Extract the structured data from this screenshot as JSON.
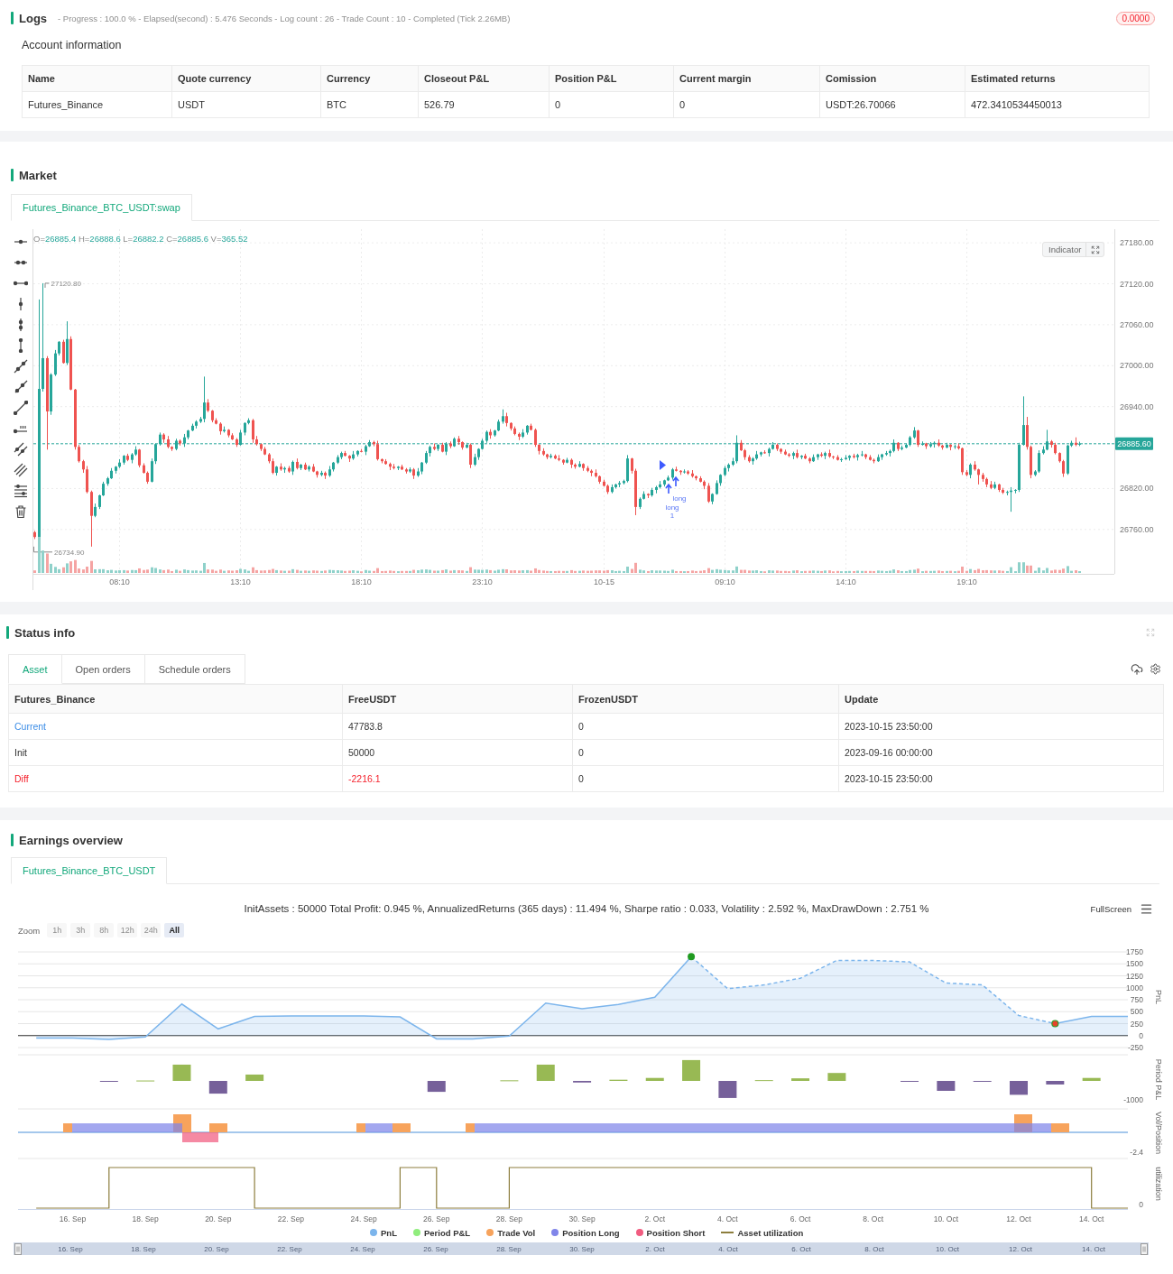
{
  "logs": {
    "title": "Logs",
    "summary": "- Progress : 100.0 % - Elapsed(second) : 5.476 Seconds - Log count : 26 - Trade Count : 10 - Completed (Tick 2.26MB)",
    "badge": "0.0000"
  },
  "account": {
    "title": "Account information",
    "columns": [
      "Name",
      "Quote currency",
      "Currency",
      "Closeout P&L",
      "Position P&L",
      "Current margin",
      "Comission",
      "Estimated returns"
    ],
    "rows": [
      [
        "Futures_Binance",
        "USDT",
        "BTC",
        "526.79",
        "0",
        "0",
        "USDT:26.70066",
        "472.3410534450013"
      ]
    ]
  },
  "market": {
    "title": "Market",
    "tabs": [
      {
        "label": "Futures_Binance_BTC_USDT:swap",
        "selected": true
      }
    ],
    "chart": {
      "readout": [
        {
          "key": "O=",
          "value": "26885.4"
        },
        {
          "key": "H=",
          "value": "26888.6"
        },
        {
          "key": "L=",
          "value": "26882.2"
        },
        {
          "key": "C=",
          "value": "26885.6"
        },
        {
          "key": "V=",
          "value": "365.52"
        }
      ],
      "indicator": "Indicator",
      "high_label": "27120.80",
      "low_label": "26734.90",
      "signals": [
        {
          "label": "long"
        },
        {
          "label": "long",
          "count": "1"
        }
      ],
      "chart_data": {
        "type": "candlestick",
        "grid": true,
        "ylim": [
          26695,
          27200
        ],
        "yticks": [
          {
            "value": 27180,
            "label": "27180.00"
          },
          {
            "value": 27120,
            "label": "27120.00"
          },
          {
            "value": 27060,
            "label": "27060.00"
          },
          {
            "value": 27000,
            "label": "27000.00"
          },
          {
            "value": 26940,
            "label": "26940.00"
          },
          {
            "value": 26820,
            "label": "26820.00"
          },
          {
            "value": 26760,
            "label": "26760.00"
          }
        ],
        "ref_lines": [
          {
            "axis": "y",
            "value": 26885.6,
            "label": "26885.60"
          }
        ],
        "categories": [
          null,
          null,
          null,
          null,
          null,
          null,
          null,
          null,
          null,
          null,
          null,
          null,
          null,
          null,
          null,
          null,
          null,
          null,
          null,
          null,
          null,
          "08:10",
          null,
          null,
          null,
          null,
          null,
          null,
          null,
          null,
          null,
          null,
          null,
          null,
          null,
          null,
          null,
          null,
          null,
          null,
          null,
          null,
          null,
          null,
          null,
          null,
          null,
          null,
          null,
          null,
          null,
          "13:10",
          null,
          null,
          null,
          null,
          null,
          null,
          null,
          null,
          null,
          null,
          null,
          null,
          null,
          null,
          null,
          null,
          null,
          null,
          null,
          null,
          null,
          null,
          null,
          null,
          null,
          null,
          null,
          null,
          null,
          "18:10",
          null,
          null,
          null,
          null,
          null,
          null,
          null,
          null,
          null,
          null,
          null,
          null,
          null,
          null,
          null,
          null,
          null,
          null,
          null,
          null,
          null,
          null,
          null,
          null,
          null,
          null,
          null,
          null,
          null,
          "23:10",
          null,
          null,
          null,
          null,
          null,
          null,
          null,
          null,
          null,
          null,
          null,
          null,
          null,
          null,
          null,
          null,
          null,
          null,
          null,
          null,
          null,
          null,
          null,
          null,
          null,
          null,
          null,
          null,
          null,
          "10-15",
          null,
          null,
          null,
          null,
          null,
          null,
          null,
          null,
          null,
          null,
          null,
          null,
          null,
          null,
          null,
          null,
          null,
          null,
          null,
          null,
          null,
          null,
          null,
          null,
          null,
          null,
          null,
          null,
          null,
          "09:10",
          null,
          null,
          null,
          null,
          null,
          null,
          null,
          null,
          null,
          null,
          null,
          null,
          null,
          null,
          null,
          null,
          null,
          null,
          null,
          null,
          null,
          null,
          null,
          null,
          null,
          null,
          null,
          null,
          null,
          "14:10",
          null,
          null,
          null,
          null,
          null,
          null,
          null,
          null,
          null,
          null,
          null,
          null,
          null,
          null,
          null,
          null,
          null,
          null,
          null,
          null,
          null,
          null,
          null,
          null,
          null,
          null,
          null,
          null,
          null,
          "19:10",
          null,
          null,
          null,
          null,
          null,
          null,
          null,
          null,
          null,
          null,
          null,
          null,
          null,
          null,
          null,
          null,
          null,
          null,
          null,
          null,
          null,
          null,
          null,
          null,
          null,
          null,
          null,
          null
        ],
        "ohlc": [
          [
            26756,
            26758,
            26746,
            26749
          ],
          [
            26749,
            27097,
            26748,
            26966
          ],
          [
            26966,
            27120.8,
            26962,
            27011
          ],
          [
            27011,
            27014,
            26877,
            26933
          ],
          [
            26933,
            26989,
            26928,
            26987
          ],
          [
            26987,
            27023,
            26985,
            27018
          ],
          [
            27018,
            27036,
            27015,
            27035
          ],
          [
            27035,
            27038,
            27003,
            27004
          ],
          [
            27004,
            27065,
            27001,
            27039
          ],
          [
            27039,
            27043,
            26964,
            26965
          ],
          [
            26965,
            26966,
            26877,
            26881
          ],
          [
            26881,
            26884,
            26858,
            26860
          ],
          [
            26860,
            26862,
            26843,
            26848
          ],
          [
            26848,
            26853,
            26813,
            26815
          ],
          [
            26815,
            26817,
            26734.9,
            26780
          ],
          [
            26780,
            26798,
            26778,
            26793
          ],
          [
            26793,
            26811,
            26790,
            26810
          ],
          [
            26810,
            26830,
            26809,
            26827
          ],
          [
            26827,
            26837,
            26824,
            26835
          ],
          [
            26835,
            26850,
            26834,
            26846
          ],
          [
            26846,
            26853,
            26842,
            26852
          ],
          [
            26852,
            26863,
            26850,
            26858
          ],
          [
            26858,
            26869,
            26855,
            26868
          ],
          [
            26868,
            26871,
            26860,
            26862
          ],
          [
            26862,
            26872,
            26857,
            26870
          ],
          [
            26870,
            26882,
            26868,
            26877
          ],
          [
            26877,
            26878,
            26851,
            26854
          ],
          [
            26854,
            26857,
            26842,
            26843
          ],
          [
            26843,
            26845,
            26827,
            26830
          ],
          [
            26830,
            26864,
            26829,
            26860
          ],
          [
            26860,
            26886,
            26856,
            26885
          ],
          [
            26885,
            26902,
            26883,
            26899
          ],
          [
            26899,
            26901,
            26887,
            26892
          ],
          [
            26892,
            26897,
            26879,
            26881
          ],
          [
            26881,
            26882,
            26875,
            26878
          ],
          [
            26878,
            26893,
            26876,
            26890
          ],
          [
            26890,
            26892,
            26883,
            26886
          ],
          [
            26886,
            26900,
            26881,
            26895
          ],
          [
            26895,
            26906,
            26892,
            26905
          ],
          [
            26905,
            26915,
            26904,
            26912
          ],
          [
            26912,
            26920,
            26908,
            26918
          ],
          [
            26918,
            26925,
            26916,
            26922
          ],
          [
            26922,
            26984,
            26917,
            26946
          ],
          [
            26946,
            26951,
            26932,
            26934
          ],
          [
            26934,
            26935,
            26917,
            26920
          ],
          [
            26920,
            26923,
            26914,
            26915
          ],
          [
            26915,
            26917,
            26899,
            26904
          ],
          [
            26904,
            26911,
            26902,
            26906
          ],
          [
            26906,
            26907,
            26895,
            26898
          ],
          [
            26898,
            26901,
            26891,
            26892
          ],
          [
            26892,
            26894,
            26881,
            26884
          ],
          [
            26884,
            26906,
            26883,
            26902
          ],
          [
            26902,
            26917,
            26898,
            26916
          ],
          [
            26916,
            26923,
            26914,
            26920
          ],
          [
            26920,
            26922,
            26887,
            26892
          ],
          [
            26892,
            26897,
            26883,
            26885
          ],
          [
            26885,
            26886,
            26875,
            26878
          ],
          [
            26878,
            26881,
            26869,
            26870
          ],
          [
            26870,
            26872,
            26857,
            26860
          ],
          [
            26860,
            26864,
            26841,
            26843
          ],
          [
            26843,
            26853,
            26839,
            26852
          ],
          [
            26852,
            26857,
            26846,
            26848
          ],
          [
            26848,
            26852,
            26843,
            26850
          ],
          [
            26850,
            26853,
            26843,
            26845
          ],
          [
            26845,
            26861,
            26840,
            26859
          ],
          [
            26859,
            26864,
            26848,
            26850
          ],
          [
            26850,
            26856,
            26847,
            26855
          ],
          [
            26855,
            26858,
            26847,
            26848
          ],
          [
            26848,
            26854,
            26845,
            26852
          ],
          [
            26852,
            26856,
            26844,
            26845
          ],
          [
            26845,
            26846,
            26836,
            26840
          ],
          [
            26840,
            26846,
            26838,
            26843
          ],
          [
            26843,
            26845,
            26834,
            26839
          ],
          [
            26839,
            26853,
            26837,
            26848
          ],
          [
            26848,
            26859,
            26845,
            26858
          ],
          [
            26858,
            26869,
            26856,
            26866
          ],
          [
            26866,
            26874,
            26863,
            26872
          ],
          [
            26872,
            26875,
            26867,
            26868
          ],
          [
            26868,
            26869,
            26859,
            26864
          ],
          [
            26864,
            26875,
            26862,
            26870
          ],
          [
            26870,
            26876,
            26867,
            26875
          ],
          [
            26875,
            26878,
            26873,
            26874
          ],
          [
            26874,
            26884,
            26869,
            26882
          ],
          [
            26882,
            26891,
            26881,
            26888
          ],
          [
            26888,
            26890,
            26882,
            26885
          ],
          [
            26885,
            26890,
            26861,
            26863
          ],
          [
            26863,
            26864,
            26857,
            26860
          ],
          [
            26860,
            26863,
            26855,
            26856
          ],
          [
            26856,
            26858,
            26847,
            26852
          ],
          [
            26852,
            26856,
            26848,
            26850
          ],
          [
            26850,
            26853,
            26847,
            26852
          ],
          [
            26852,
            26855,
            26847,
            26848
          ],
          [
            26848,
            26850,
            26842,
            26845
          ],
          [
            26845,
            26851,
            26843,
            26848
          ],
          [
            26848,
            26850,
            26834,
            26839
          ],
          [
            26839,
            26850,
            26837,
            26845
          ],
          [
            26845,
            26859,
            26841,
            26858
          ],
          [
            26858,
            26875,
            26856,
            26872
          ],
          [
            26872,
            26883,
            26867,
            26881
          ],
          [
            26881,
            26886,
            26876,
            26878
          ],
          [
            26878,
            26885,
            26875,
            26884
          ],
          [
            26884,
            26887,
            26873,
            26874
          ],
          [
            26874,
            26888,
            26869,
            26886
          ],
          [
            26886,
            26889,
            26879,
            26882
          ],
          [
            26882,
            26895,
            26881,
            26893
          ],
          [
            26893,
            26897,
            26884,
            26888
          ],
          [
            26888,
            26889,
            26877,
            26880
          ],
          [
            26880,
            26887,
            26879,
            26884
          ],
          [
            26884,
            26886,
            26850,
            26855
          ],
          [
            26855,
            26871,
            26853,
            26866
          ],
          [
            26866,
            26879,
            26862,
            26878
          ],
          [
            26878,
            26893,
            26877,
            26890
          ],
          [
            26890,
            26905,
            26887,
            26903
          ],
          [
            26903,
            26907,
            26893,
            26898
          ],
          [
            26898,
            26906,
            26896,
            26905
          ],
          [
            26905,
            26921,
            26904,
            26918
          ],
          [
            26918,
            26936,
            26915,
            26926
          ],
          [
            26926,
            26931,
            26911,
            26916
          ],
          [
            26916,
            26917,
            26905,
            26908
          ],
          [
            26908,
            26911,
            26898,
            26900
          ],
          [
            26900,
            26902,
            26891,
            26896
          ],
          [
            26896,
            26907,
            26894,
            26902
          ],
          [
            26902,
            26913,
            26899,
            26912
          ],
          [
            26912,
            26915,
            26905,
            26906
          ],
          [
            26906,
            26908,
            26881,
            26884
          ],
          [
            26884,
            26885,
            26870,
            26875
          ],
          [
            26875,
            26879,
            26868,
            26870
          ],
          [
            26870,
            26871,
            26863,
            26866
          ],
          [
            26866,
            26871,
            26864,
            26868
          ],
          [
            26868,
            26870,
            26863,
            26864
          ],
          [
            26864,
            26869,
            26860,
            26862
          ],
          [
            26862,
            26863,
            26855,
            26858
          ],
          [
            26858,
            26865,
            26857,
            26862
          ],
          [
            26862,
            26864,
            26850,
            26855
          ],
          [
            26855,
            26857,
            26849,
            26852
          ],
          [
            26852,
            26860,
            26851,
            26856
          ],
          [
            26856,
            26857,
            26846,
            26850
          ],
          [
            26850,
            26853,
            26844,
            26846
          ],
          [
            26846,
            26848,
            26838,
            26843
          ],
          [
            26843,
            26848,
            26836,
            26838
          ],
          [
            26838,
            26839,
            26827,
            26830
          ],
          [
            26830,
            26833,
            26823,
            26824
          ],
          [
            26824,
            26826,
            26812,
            26815
          ],
          [
            26815,
            26826,
            26813,
            26822
          ],
          [
            26822,
            26827,
            26820,
            26826
          ],
          [
            26826,
            26831,
            26822,
            26828
          ],
          [
            26828,
            26833,
            26826,
            26831
          ],
          [
            26831,
            26869,
            26829,
            26864
          ],
          [
            26864,
            26865,
            26842,
            26846
          ],
          [
            26846,
            26849,
            26781,
            26793
          ],
          [
            26793,
            26807,
            26790,
            26805
          ],
          [
            26805,
            26816,
            26804,
            26812
          ],
          [
            26812,
            26813,
            26806,
            26810
          ],
          [
            26810,
            26821,
            26808,
            26818
          ],
          [
            26818,
            26824,
            26813,
            26822
          ],
          [
            26822,
            26831,
            26820,
            26826
          ],
          [
            26826,
            26833,
            26823,
            26832
          ],
          [
            26832,
            26839,
            26831,
            26836
          ],
          [
            26836,
            26850,
            26833,
            26848
          ],
          [
            26848,
            26852,
            26845,
            26846
          ],
          [
            26846,
            26847,
            26840,
            26844
          ],
          [
            26844,
            26848,
            26842,
            26845
          ],
          [
            26845,
            26847,
            26840,
            26842
          ],
          [
            26842,
            26847,
            26836,
            26838
          ],
          [
            26838,
            26839,
            26832,
            26835
          ],
          [
            26835,
            26838,
            26829,
            26830
          ],
          [
            26830,
            26832,
            26819,
            26824
          ],
          [
            26824,
            26828,
            26799,
            26801
          ],
          [
            26801,
            26813,
            26797,
            26812
          ],
          [
            26812,
            26832,
            26811,
            26828
          ],
          [
            26828,
            26841,
            26824,
            26840
          ],
          [
            26840,
            26853,
            26838,
            26850
          ],
          [
            26850,
            26857,
            26845,
            26855
          ],
          [
            26855,
            26865,
            26853,
            26860
          ],
          [
            26860,
            26898,
            26857,
            26887
          ],
          [
            26887,
            26891,
            26875,
            26876
          ],
          [
            26876,
            26878,
            26862,
            26866
          ],
          [
            26866,
            26869,
            26858,
            26860
          ],
          [
            26860,
            26866,
            26855,
            26864
          ],
          [
            26864,
            26875,
            26862,
            26870
          ],
          [
            26870,
            26874,
            26867,
            26873
          ],
          [
            26873,
            26876,
            26871,
            26872
          ],
          [
            26872,
            26880,
            26867,
            26878
          ],
          [
            26878,
            26888,
            26877,
            26884
          ],
          [
            26884,
            26886,
            26875,
            26878
          ],
          [
            26878,
            26879,
            26871,
            26874
          ],
          [
            26874,
            26877,
            26869,
            26870
          ],
          [
            26870,
            26872,
            26866,
            26868
          ],
          [
            26868,
            26874,
            26863,
            26872
          ],
          [
            26872,
            26877,
            26864,
            26866
          ],
          [
            26866,
            26869,
            26863,
            26868
          ],
          [
            26868,
            26871,
            26863,
            26864
          ],
          [
            26864,
            26866,
            26857,
            26860
          ],
          [
            26860,
            26870,
            26859,
            26866
          ],
          [
            26866,
            26871,
            26862,
            26870
          ],
          [
            26870,
            26873,
            26866,
            26868
          ],
          [
            26868,
            26874,
            26863,
            26872
          ],
          [
            26872,
            26877,
            26865,
            26867
          ],
          [
            26867,
            26868,
            26863,
            26866
          ],
          [
            26866,
            26869,
            26861,
            26862
          ],
          [
            26862,
            26865,
            26859,
            26863
          ],
          [
            26863,
            26869,
            26862,
            26865
          ],
          [
            26865,
            26869,
            26861,
            26868
          ],
          [
            26868,
            26871,
            26864,
            26866
          ],
          [
            26866,
            26871,
            26861,
            26869
          ],
          [
            26869,
            26875,
            26867,
            26870
          ],
          [
            26870,
            26871,
            26863,
            26866
          ],
          [
            26866,
            26869,
            26861,
            26862
          ],
          [
            26862,
            26864,
            26857,
            26860
          ],
          [
            26860,
            26870,
            26859,
            26866
          ],
          [
            26866,
            26871,
            26862,
            26870
          ],
          [
            26870,
            26875,
            26868,
            26872
          ],
          [
            26872,
            26877,
            26867,
            26875
          ],
          [
            26875,
            26892,
            26873,
            26887
          ],
          [
            26887,
            26888,
            26875,
            26878
          ],
          [
            26878,
            26883,
            26876,
            26880
          ],
          [
            26880,
            26886,
            26879,
            26884
          ],
          [
            26884,
            26897,
            26882,
            26895
          ],
          [
            26895,
            26910,
            26893,
            26905
          ],
          [
            26905,
            26906,
            26881,
            26884
          ],
          [
            26884,
            26889,
            26883,
            26886
          ],
          [
            26886,
            26887,
            26878,
            26882
          ],
          [
            26882,
            26888,
            26880,
            26885
          ],
          [
            26885,
            26889,
            26880,
            26887
          ],
          [
            26887,
            26892,
            26881,
            26883
          ],
          [
            26883,
            26884,
            26877,
            26880
          ],
          [
            26880,
            26887,
            26879,
            26884
          ],
          [
            26884,
            26885,
            26876,
            26881
          ],
          [
            26881,
            26884,
            26878,
            26882
          ],
          [
            26882,
            26886,
            26877,
            26879
          ],
          [
            26879,
            26880,
            26840,
            26844
          ],
          [
            26844,
            26847,
            26838,
            26840
          ],
          [
            26840,
            26857,
            26835,
            26855
          ],
          [
            26855,
            26860,
            26846,
            26848
          ],
          [
            26848,
            26849,
            26826,
            26840
          ],
          [
            26840,
            26843,
            26830,
            26834
          ],
          [
            26834,
            26836,
            26822,
            26826
          ],
          [
            26826,
            26831,
            26819,
            26821
          ],
          [
            26821,
            26830,
            26819,
            26826
          ],
          [
            26826,
            26827,
            26815,
            26818
          ],
          [
            26818,
            26821,
            26812,
            26814
          ],
          [
            26814,
            26817,
            26810,
            26815
          ],
          [
            26815,
            26822,
            26786,
            26817
          ],
          [
            26817,
            26819,
            26813,
            26818
          ],
          [
            26818,
            26887,
            26815,
            26884
          ],
          [
            26884,
            26955,
            26883,
            26913
          ],
          [
            26913,
            26925,
            26877,
            26881
          ],
          [
            26881,
            26883,
            26835,
            26840
          ],
          [
            26840,
            26847,
            26838,
            26845
          ],
          [
            26845,
            26876,
            26843,
            26872
          ],
          [
            26872,
            26882,
            26870,
            26877
          ],
          [
            26877,
            26906,
            26876,
            26889
          ],
          [
            26889,
            26891,
            26880,
            26884
          ],
          [
            26884,
            26887,
            26870,
            26872
          ],
          [
            26872,
            26873,
            26858,
            26860
          ],
          [
            26860,
            26862,
            26837,
            26842
          ],
          [
            26842,
            26884,
            26840,
            26883
          ],
          [
            26883,
            26890,
            26881,
            26887
          ],
          [
            26887,
            26895,
            26882,
            26884
          ],
          [
            26885.4,
            26888.6,
            26882.2,
            26885.6
          ]
        ]
      }
    }
  },
  "status": {
    "title": "Status info",
    "tabs": [
      {
        "label": "Asset",
        "selected": true
      },
      {
        "label": "Open orders",
        "selected": false
      },
      {
        "label": "Schedule orders",
        "selected": false
      }
    ],
    "table": {
      "columns": [
        "Futures_Binance",
        "FreeUSDT",
        "FrozenUSDT",
        "Update"
      ],
      "rows": [
        {
          "cells": [
            {
              "text": "Current",
              "color": "#3c8de6"
            },
            {
              "text": "47783.8"
            },
            {
              "text": "0"
            },
            {
              "text": "2023-10-15 23:50:00"
            }
          ]
        },
        {
          "cells": [
            {
              "text": "Init"
            },
            {
              "text": "50000"
            },
            {
              "text": "0"
            },
            {
              "text": "2023-09-16 00:00:00"
            }
          ]
        },
        {
          "cells": [
            {
              "text": "Diff",
              "color": "#f5222d"
            },
            {
              "text": "-2216.1",
              "color": "#f5222d"
            },
            {
              "text": "0"
            },
            {
              "text": "2023-10-15 23:50:00"
            }
          ]
        }
      ]
    }
  },
  "earnings": {
    "title": "Earnings overview",
    "tabs": [
      {
        "label": "Futures_Binance_BTC_USDT",
        "selected": true
      }
    ],
    "summary": "InitAssets : 50000 Total Profit: 0.945 %, AnnualizedReturns (365 days) : 11.494 %, Sharpe ratio : 0.033, Volatility : 2.592 %, MaxDrawDown : 2.751 %",
    "fullscreen": "FullScreen",
    "zoom": {
      "label": "Zoom",
      "buttons": [
        {
          "label": "1h",
          "selected": false,
          "disabled": true
        },
        {
          "label": "3h",
          "selected": false,
          "disabled": true
        },
        {
          "label": "8h",
          "selected": false,
          "disabled": true
        },
        {
          "label": "12h",
          "selected": false,
          "disabled": true
        },
        {
          "label": "24h",
          "selected": false,
          "disabled": true
        },
        {
          "label": "All",
          "selected": true,
          "disabled": false
        }
      ]
    },
    "chart_data": {
      "type": "area",
      "ylabel": "PnL",
      "grid": true,
      "categories": [
        null,
        null,
        null,
        null,
        null,
        null,
        null,
        null,
        null,
        null,
        null,
        null,
        null,
        null,
        null,
        null,
        null,
        null,
        null,
        null,
        null,
        null,
        null,
        null,
        null,
        null,
        null,
        null,
        null,
        null,
        null
      ],
      "series": [
        {
          "color": "#7cb5ec",
          "values": [
            -50,
            -50,
            -80,
            -30,
            660,
            140,
            400,
            410,
            410,
            410,
            390,
            -70,
            -70,
            -10,
            680,
            560,
            650,
            800,
            1650,
            980,
            1060,
            1200,
            1570,
            1570,
            1540,
            1100,
            1060,
            420,
            250,
            400,
            400
          ]
        }
      ],
      "ylim": [
        -250,
        1750
      ],
      "yticks": [
        -250,
        0,
        250,
        500,
        750,
        1000,
        1250,
        1500,
        1750
      ]
    },
    "panels": [
      {
        "kind": "period_pnl",
        "label": "Period P&L",
        "tick": "-1000"
      },
      {
        "kind": "volume",
        "label": "Vol/Position",
        "tick": "-2.4"
      },
      {
        "kind": "utilization",
        "label": "utilization",
        "tick": "0"
      }
    ],
    "x_axis": {
      "labels": [
        "16. Sep",
        "18. Sep",
        "20. Sep",
        "22. Sep",
        "24. Sep",
        "26. Sep",
        "28. Sep",
        "30. Sep",
        "2. Oct",
        "4. Oct",
        "6. Oct",
        "8. Oct",
        "10. Oct",
        "12. Oct",
        "14. Oct"
      ]
    },
    "legend": [
      {
        "label": "PnL",
        "color": "#7cb5ec",
        "kind": "dot"
      },
      {
        "label": "Period P&L",
        "color": "#90ed7d",
        "kind": "dot"
      },
      {
        "label": "Trade Vol",
        "color": "#f7a35c",
        "kind": "dot"
      },
      {
        "label": "Position Long",
        "color": "#8085e9",
        "kind": "dot"
      },
      {
        "label": "Position Short",
        "color": "#f15c80",
        "kind": "dot"
      },
      {
        "label": "Asset utilization",
        "color": "#8d7e3e",
        "kind": "line"
      }
    ],
    "navigator": {
      "labels": [
        "16. Sep",
        "18. Sep",
        "20. Sep",
        "22. Sep",
        "24. Sep",
        "26. Sep",
        "28. Sep",
        "30. Sep",
        "2. Oct",
        "4. Oct",
        "6. Oct",
        "8. Oct",
        "10. Oct",
        "12. Oct",
        "14. Oct"
      ]
    }
  }
}
